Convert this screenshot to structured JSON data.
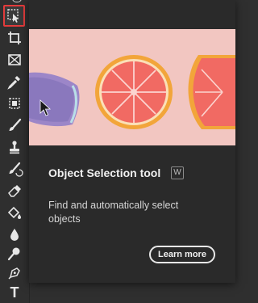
{
  "toolbar": {
    "tools": [
      {
        "name": "object-selection-icon",
        "active": true
      },
      {
        "name": "crop-icon"
      },
      {
        "name": "frame-icon"
      },
      {
        "name": "eyedropper-icon"
      },
      {
        "name": "spot-healing-icon"
      },
      {
        "name": "brush-icon"
      },
      {
        "name": "clone-stamp-icon"
      },
      {
        "name": "history-brush-icon"
      },
      {
        "name": "eraser-icon"
      },
      {
        "name": "paint-bucket-icon"
      },
      {
        "name": "blur-icon"
      },
      {
        "name": "dodge-icon"
      },
      {
        "name": "pen-icon"
      },
      {
        "name": "type-icon",
        "glyph": "T"
      }
    ],
    "active_highlight_color": "#e23b3b"
  },
  "popup": {
    "title": "Object Selection tool",
    "shortcut": "W",
    "description": "Find and automatically select objects",
    "learn_more_label": "Learn more"
  }
}
